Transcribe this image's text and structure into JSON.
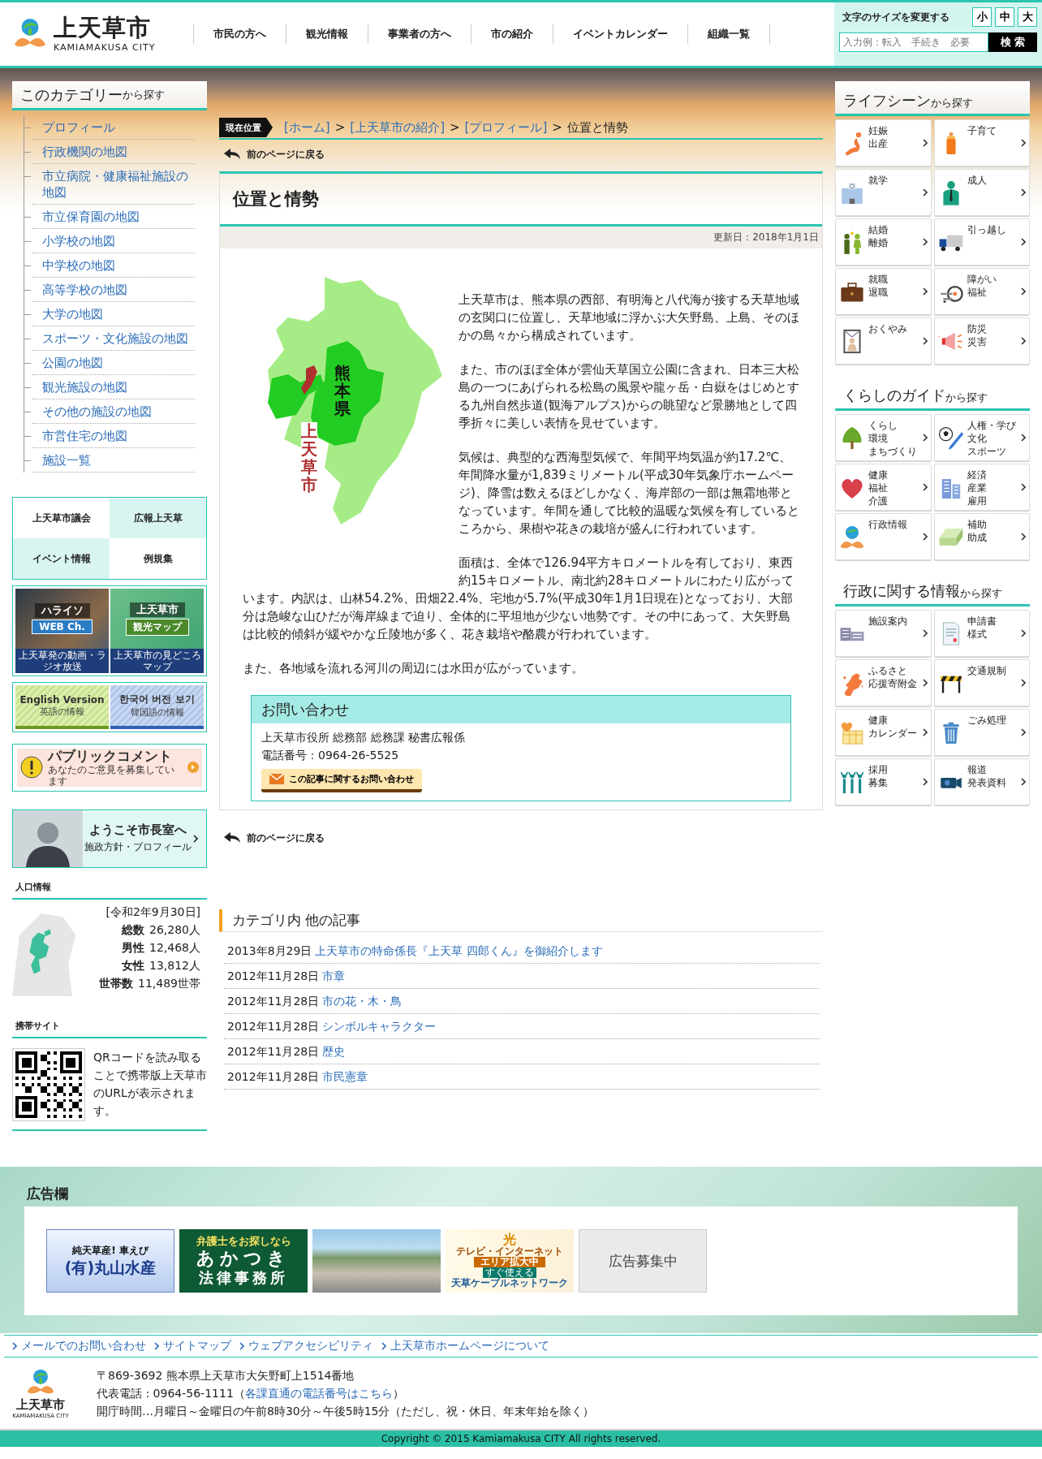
{
  "header": {
    "logo_title": "上天草市",
    "logo_subtitle": "KAMIAMAKUSA CITY",
    "nav": [
      "市民の方へ",
      "観光情報",
      "事業者の方へ",
      "市の紹介",
      "イベントカレンダー",
      "組織一覧"
    ],
    "font_size_label": "文字のサイズを変更する",
    "font_sizes": [
      "小",
      "中",
      "大"
    ],
    "search": {
      "placeholder": "入力例：転入　手続き　必要",
      "button": "検 索"
    }
  },
  "left": {
    "category_title": "このカテゴリー",
    "category_suffix": "から探す",
    "category_items": [
      "プロフィール",
      "行政機関の地図",
      "市立病院・健康福祉施設の地図",
      "市立保育園の地図",
      "小学校の地図",
      "中学校の地図",
      "高等学校の地図",
      "大学の地図",
      "スポーツ・文化施設の地図",
      "公園の地図",
      "観光施設の地図",
      "その他の施設の地図",
      "市営住宅の地図",
      "施設一覧"
    ],
    "quick_links": [
      "上天草市議会",
      "広報上天草",
      "イベント情報",
      "例規集"
    ],
    "banners": [
      {
        "title": "ハライソ",
        "badge": "WEB Ch.",
        "caption": "上天草発の動画・ラジオ放送"
      },
      {
        "title": "上天草市",
        "badge": "観光マップ",
        "caption": "上天草市の見どころマップ"
      }
    ],
    "language_banners": [
      {
        "title": "English Version",
        "caption": "英語の情報"
      },
      {
        "title": "한국어 버전 보기",
        "caption": "韓国語の情報"
      }
    ],
    "public_comment": {
      "title": "パブリックコメント",
      "caption": "あなたのご意見を募集しています"
    },
    "mayor": {
      "title": "ようこそ市長室へ",
      "caption": "施政方針・プロフィール"
    },
    "population": {
      "heading": "人口情報",
      "date": "[令和2年9月30日]",
      "rows": [
        {
          "label": "総数",
          "value": "26,280人"
        },
        {
          "label": "男性",
          "value": "12,468人"
        },
        {
          "label": "女性",
          "value": "13,812人"
        },
        {
          "label": "世帯数",
          "value": "11,489世帯"
        }
      ]
    },
    "mobile": {
      "heading": "携帯サイト",
      "text": "QRコードを読み取ることで携帯版上天草市のURLが表示されます。"
    }
  },
  "main": {
    "breadcrumb_label": "現在位置",
    "breadcrumb_separator": ">",
    "breadcrumb": [
      {
        "text": "[ホーム]",
        "link": true
      },
      {
        "text": "[上天草市の紹介]",
        "link": true
      },
      {
        "text": "[プロフィール]",
        "link": true
      },
      {
        "text": "位置と情勢",
        "link": false
      }
    ],
    "back_link_top": "前のページに戻る",
    "title": "位置と情勢",
    "updated": "更新日：2018年1月1日",
    "map": {
      "prefecture": "熊本県",
      "city": "上天草市"
    },
    "paragraphs": [
      "上天草市は、熊本県の西部、有明海と八代海が接する天草地域の玄関口に位置し、天草地域に浮かぶ大矢野島、上島、そのほかの島々から構成されています。",
      "また、市のほぼ全体が雲仙天草国立公園に含まれ、日本三大松島の一つにあげられる松島の風景や龍ヶ岳・白嶽をはじめとする九州自然歩道(観海アルプス)からの眺望など景勝地として四季折々に美しい表情を見せています。",
      "気候は、典型的な西海型気候で、年間平均気温が約17.2℃、年間降水量が1,839ミリメートル(平成30年気象庁ホームページ)、降雪は数えるほどしかなく、海岸部の一部は無霜地帯となっています。年間を通して比較的温暖な気候を有しているところから、果樹や花きの栽培が盛んに行われています。",
      "面積は、全体で126.94平方キロメートルを有しており、東西約15キロメートル、南北約28キロメートルにわたり広がっています。内訳は、山林54.2%、田畑22.4%、宅地が5.7%(平成30年1月1日現在)となっており、大部分は急峻な山ひだが海岸線まで迫り、全体的に平坦地が少ない地勢です。その中にあって、大矢野島は比較的傾斜が緩やかな丘陵地が多く、花き栽培や酪農が行われています。",
      "また、各地域を流れる河川の周辺には水田が広がっています。"
    ],
    "contact": {
      "heading": "お問い合わせ",
      "lines": [
        "上天草市役所 総務部 総務課 秘書広報係",
        "電話番号：0964-26-5525"
      ],
      "button": "この記事に関するお問い合わせ"
    },
    "back_link_bottom": "前のページに戻る",
    "related": {
      "heading": "カテゴリ内 他の記事",
      "items": [
        {
          "date": "2013年8月29日",
          "title": "上天草市の特命係長『上天草 四郎くん』を御紹介します"
        },
        {
          "date": "2012年11月28日",
          "title": "市章"
        },
        {
          "date": "2012年11月28日",
          "title": "市の花・木・鳥"
        },
        {
          "date": "2012年11月28日",
          "title": "シンボルキャラクター"
        },
        {
          "date": "2012年11月28日",
          "title": "歴史"
        },
        {
          "date": "2012年11月28日",
          "title": "市民憲章"
        }
      ]
    }
  },
  "right": {
    "sections": [
      {
        "title": "ライフシーン",
        "suffix": "から探す",
        "items": [
          {
            "lines": [
              "妊娠",
              "出産"
            ]
          },
          {
            "lines": [
              "子育て"
            ]
          },
          {
            "lines": [
              "就学"
            ]
          },
          {
            "lines": [
              "成人"
            ]
          },
          {
            "lines": [
              "結婚",
              "離婚"
            ]
          },
          {
            "lines": [
              "引っ越し"
            ]
          },
          {
            "lines": [
              "就職",
              "退職"
            ]
          },
          {
            "lines": [
              "障がい",
              "福祉"
            ]
          },
          {
            "lines": [
              "おくやみ"
            ]
          },
          {
            "lines": [
              "防災",
              "災害"
            ]
          }
        ]
      },
      {
        "title": "くらしのガイド",
        "suffix": "から探す",
        "items": [
          {
            "lines": [
              "くらし",
              "環境",
              "まちづくり"
            ]
          },
          {
            "lines": [
              "人権・学び",
              "文化",
              "スポーツ"
            ]
          },
          {
            "lines": [
              "健康",
              "福祉",
              "介護"
            ]
          },
          {
            "lines": [
              "経済",
              "産業",
              "雇用"
            ]
          },
          {
            "lines": [
              "行政情報"
            ]
          },
          {
            "lines": [
              "補助",
              "助成"
            ]
          }
        ]
      },
      {
        "title": "行政に関する情報",
        "suffix": "から探す",
        "items": [
          {
            "lines": [
              "施設案内"
            ]
          },
          {
            "lines": [
              "申請書",
              "様式"
            ]
          },
          {
            "lines": [
              "ふるさと",
              "応援寄附金"
            ]
          },
          {
            "lines": [
              "交通規制"
            ]
          },
          {
            "lines": [
              "健康",
              "カレンダー"
            ]
          },
          {
            "lines": [
              "ごみ処理"
            ]
          },
          {
            "lines": [
              "採用",
              "募集"
            ]
          },
          {
            "lines": [
              "報道",
              "発表資料"
            ]
          }
        ]
      }
    ]
  },
  "footer": {
    "ad_heading": "広告欄",
    "ads": [
      {
        "kind": "banner",
        "lines": [
          "純天草産! 車えび",
          "(有)丸山水産"
        ]
      },
      {
        "kind": "banner",
        "lines": [
          "弁護士をお探しなら",
          "あかつき",
          "法律事務所"
        ]
      },
      {
        "kind": "photo"
      },
      {
        "kind": "banner",
        "lines": [
          "光",
          "テレビ・インターネット",
          "エリア拡大中",
          "すぐ使える",
          "天草ケーブルネットワーク"
        ]
      },
      {
        "kind": "placeholder",
        "lines": [
          "広告募集中"
        ]
      }
    ],
    "links": [
      "メールでのお問い合わせ",
      "サイトマップ",
      "ウェブアクセシビリティ",
      "上天草市ホームページについて"
    ],
    "logo_title": "上天草市",
    "logo_subtitle": "KAMIAMAKUSA CITY",
    "address": "〒869-3692 熊本県上天草市大矢野町上1514番地",
    "phone_prefix": "代表電話 : 0964-56-1111（",
    "phone_link": "各課直通の電話番号はこちら",
    "phone_suffix": "）",
    "hours": "開庁時間…月曜日～金曜日の午前8時30分～午後5時15分（ただし、祝・休日、年末年始を除く）",
    "copyright": "Copyright © 2015 Kamiamakusa CITY All rights reserved."
  }
}
